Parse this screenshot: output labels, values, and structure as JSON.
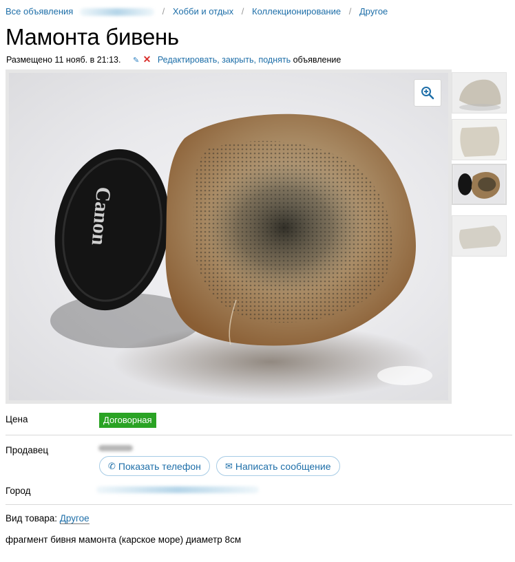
{
  "breadcrumbs": {
    "all_ads": "Все объявления",
    "hobby": "Хобби и отдых",
    "collecting": "Коллекционирование",
    "other": "Другое",
    "separator": "/"
  },
  "ad": {
    "title": "Мамонта бивень",
    "posted": "Размещено 11 нояб. в 21:13.",
    "edit_link": "Редактировать, закрыть, поднять",
    "edit_suffix": "объявление",
    "lens_text": "Canon"
  },
  "photo": {
    "zoom_icon": "zoom-in-icon",
    "thumbnail_count": 4,
    "active_thumbnail": 3
  },
  "details": {
    "price_label": "Цена",
    "price_value": "Договорная",
    "seller_label": "Продавец",
    "show_phone": "Показать телефон",
    "send_message": "Написать сообщение",
    "city_label": "Город",
    "kind_label": "Вид товара:",
    "kind_value": "Другое",
    "description": "фрагмент бивня мамонта (карское море) диаметр 8см"
  },
  "colors": {
    "link": "#1d6ea8",
    "badge": "#2aa324",
    "delete": "#d9302c"
  }
}
